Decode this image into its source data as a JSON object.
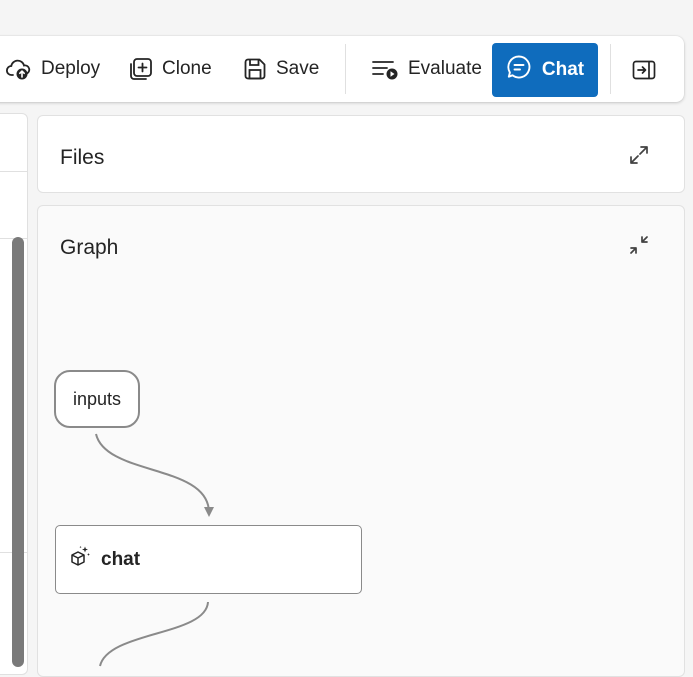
{
  "toolbar": {
    "deploy_label": "Deploy",
    "clone_label": "Clone",
    "save_label": "Save",
    "evaluate_label": "Evaluate",
    "chat_label": "Chat"
  },
  "files_panel": {
    "title": "Files"
  },
  "graph_panel": {
    "title": "Graph",
    "nodes": [
      {
        "label": "inputs"
      },
      {
        "label": "chat"
      }
    ]
  },
  "colors": {
    "accent": "#0f6cbd",
    "background": "#f5f5f5",
    "node_border": "#8a8a8a"
  }
}
